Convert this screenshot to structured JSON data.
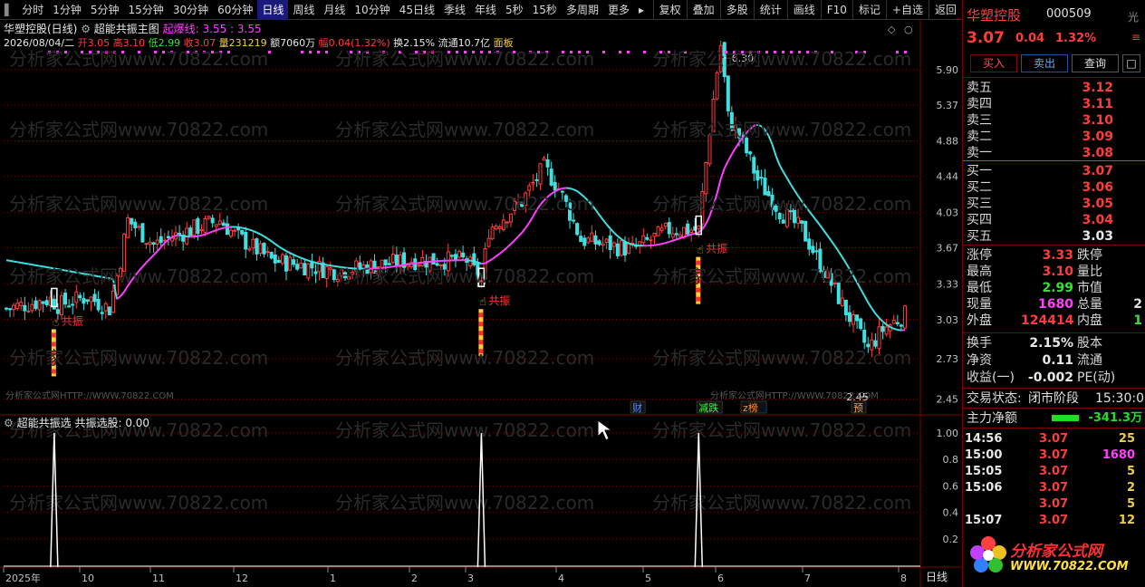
{
  "toolbar": {
    "periods": [
      "分时",
      "1分钟",
      "5分钟",
      "15分钟",
      "30分钟",
      "60分钟",
      "日线",
      "周线",
      "月线",
      "10分钟",
      "45日线",
      "季线",
      "年线",
      "5秒",
      "15秒",
      "多周期",
      "更多"
    ],
    "active_period": "日线",
    "actions": [
      "复权",
      "叠加",
      "多股",
      "统计",
      "画线",
      "F10",
      "标记",
      "+自选",
      "返回"
    ]
  },
  "chart_header": {
    "title": "华塑控股(日线)",
    "indicator_name": "超能共振主图",
    "indicator_label": "起爆线:",
    "indicator_values": "3.55 : 3.55"
  },
  "ohlc": {
    "date": "2026/08/04/二",
    "open_label": "开",
    "open": "3.05",
    "high_label": "高",
    "high": "3.10",
    "low_label": "低",
    "low": "2.99",
    "close_label": "收",
    "close": "3.07",
    "volume_label": "量",
    "volume": "231219",
    "amount_label": "额",
    "amount": "7060万",
    "change_label": "幅",
    "change": "0.04(1.32%)",
    "turnover_label": "换",
    "turnover": "2.15%",
    "float_label": "流通",
    "float": "10.7亿",
    "panel_label": "面板"
  },
  "price_axis": [
    "5.90",
    "5.37",
    "4.88",
    "4.44",
    "4.03",
    "3.67",
    "3.33",
    "3.03",
    "2.73",
    "2.45"
  ],
  "sub_axis": [
    "1.00",
    "0.8",
    "0.6",
    "0.4",
    "0.2"
  ],
  "date_axis": [
    "2025年",
    "10",
    "11",
    "12",
    "1",
    "2",
    "3",
    "4",
    "5",
    "6",
    "7",
    "8"
  ],
  "chart_annotations": {
    "high_marker": "6.30",
    "low_marker": "2.45",
    "signal_label": "共振",
    "event_tags": [
      "财",
      "减跌",
      "z榜",
      "预"
    ],
    "watermark_text": "分析家公式网www.70822.com",
    "watermark_small": "分析家公式网HTTP://WWW.70822.COM"
  },
  "sub_chart": {
    "indicator_name": "超能共振选",
    "indicator_label": "共振选股:",
    "indicator_value": "0.00",
    "period_label": "日线"
  },
  "chart_data": {
    "type": "candlestick",
    "symbol": "华塑控股",
    "ylim": [
      2.35,
      6.45
    ],
    "ma_segments_colors": [
      "#40e0e0",
      "#ff40ff"
    ],
    "signals_x_index": [
      13,
      129,
      188
    ]
  },
  "quote": {
    "name": "华塑控股",
    "code": "000509",
    "side_tag": "光",
    "price": "3.07",
    "change": "0.04",
    "change_pct": "1.32%",
    "buy_btn": "买入",
    "sell_btn": "卖出",
    "query_btn": "查询",
    "box_btn": "□",
    "asks": [
      {
        "label": "卖五",
        "price": "3.12"
      },
      {
        "label": "卖四",
        "price": "3.11"
      },
      {
        "label": "卖三",
        "price": "3.10"
      },
      {
        "label": "卖二",
        "price": "3.09"
      },
      {
        "label": "卖一",
        "price": "3.08"
      }
    ],
    "bids": [
      {
        "label": "买一",
        "price": "3.07"
      },
      {
        "label": "买二",
        "price": "3.06"
      },
      {
        "label": "买三",
        "price": "3.05"
      },
      {
        "label": "买四",
        "price": "3.04"
      },
      {
        "label": "买五",
        "price": "3.03"
      }
    ],
    "stats": [
      {
        "l1": "涨停",
        "v1": "3.33",
        "l2": "跌停",
        "v2": ""
      },
      {
        "l1": "最高",
        "v1": "3.10",
        "l2": "量比",
        "v2": ""
      },
      {
        "l1": "最低",
        "v1": "2.99",
        "l2": "市值",
        "v2": ""
      },
      {
        "l1": "现量",
        "v1": "1680",
        "l2": "总量",
        "v2": "2"
      },
      {
        "l1": "外盘",
        "v1": "124414",
        "l2": "内盘",
        "v2": "1"
      }
    ],
    "stats2": [
      {
        "l1": "换手",
        "v1": "2.15%",
        "l2": "股本",
        "v2": ""
      },
      {
        "l1": "净资",
        "v1": "0.11",
        "l2": "流通",
        "v2": ""
      },
      {
        "l1": "收益(一)",
        "v1": "-0.002",
        "l2": "PE(动)",
        "v2": ""
      }
    ],
    "trade_status_label": "交易状态:",
    "trade_status": "闭市阶段",
    "trade_time": "15:30:00",
    "net_inflow_label": "主力净额",
    "net_inflow": "-341.3万",
    "ticks": [
      {
        "time": "14:56",
        "price": "3.07",
        "vol": "25"
      },
      {
        "time": "15:00",
        "price": "3.07",
        "vol": "1680"
      },
      {
        "time": "15:05",
        "price": "3.07",
        "vol": "5"
      },
      {
        "time": "15:06",
        "price": "3.07",
        "vol": "2"
      },
      {
        "time": "",
        "price": "3.07",
        "vol": "5"
      },
      {
        "time": "15:07",
        "price": "3.07",
        "vol": "12"
      }
    ],
    "logo_text": "分析家公式网",
    "logo_url": "WWW.70822.COM"
  },
  "colors": {
    "up": "#ff3c3c",
    "down": "#40e0e0",
    "grid": "#7a0000",
    "ma_up": "#ff40ff",
    "ma_down": "#40e0e0"
  }
}
